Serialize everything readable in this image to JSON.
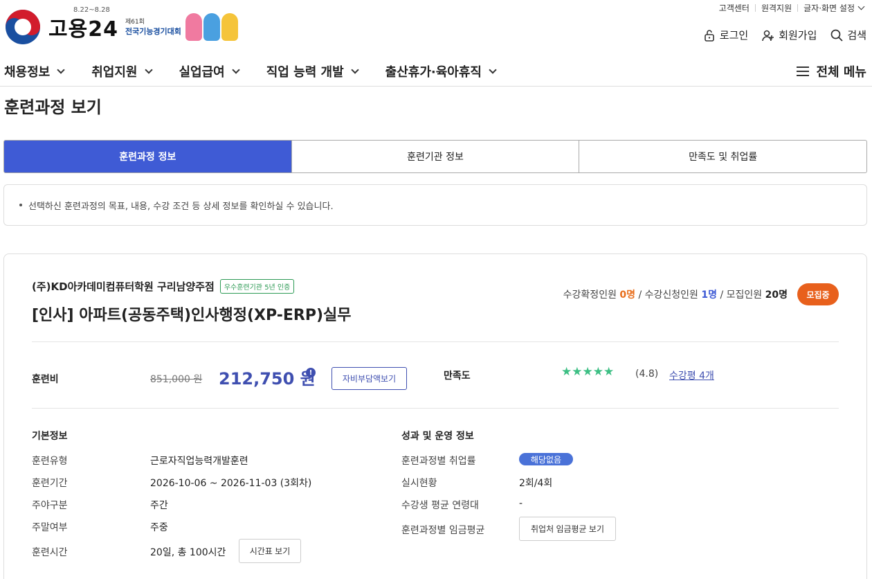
{
  "util": {
    "customer": "고객센터",
    "remote": "원격지원",
    "display": "글자·화면 설정"
  },
  "brand": {
    "name": "고용24",
    "date": "8.22~8.28",
    "event_small": "제61회",
    "event_name": "전국기능경기대회"
  },
  "account": {
    "login": "로그인",
    "signup": "회원가입",
    "search": "검색"
  },
  "gnb": {
    "items": [
      "채용정보",
      "취업지원",
      "실업급여",
      "직업 능력 개발",
      "출산휴가·육아휴직"
    ],
    "all_menu": "전체 메뉴"
  },
  "page_title": "훈련과정 보기",
  "tabs": [
    "훈련과정 정보",
    "훈련기관 정보",
    "만족도 및 취업률"
  ],
  "notice": "선택하신 훈련과정의 목표, 내용, 수강 조건 등 상세 정보를 확인하실 수 있습니다.",
  "course": {
    "org": "(주)KD아카데미컴퓨터학원 구리남양주점",
    "cert": "우수훈련기관 5년 인증",
    "title": "[인사] 아파트(공동주택)인사행정(XP-ERP)실무",
    "counts": {
      "confirmed_label": "수강확정인원",
      "confirmed": "0명",
      "applied_label": "수강신청인원",
      "applied": "1명",
      "recruit_label": "모집인원",
      "recruit": "20명"
    },
    "status": "모집중",
    "fee_label": "훈련비",
    "orig_price": "851,000 원",
    "price": "212,750 원",
    "self_pay_btn": "자비부담액보기",
    "sat_label": "만족도",
    "stars": "★★★★★",
    "score": "(4.8)",
    "reviews": "수강평 4개"
  },
  "basic": {
    "title": "기본정보",
    "rows": [
      {
        "label": "훈련유형",
        "value": "근로자직업능력개발훈련"
      },
      {
        "label": "훈련기간",
        "value": "2026-10-06 ~ 2026-11-03 (3회차)"
      },
      {
        "label": "주야구분",
        "value": "주간"
      },
      {
        "label": "주말여부",
        "value": "주중"
      },
      {
        "label": "훈련시간",
        "value": "20일, 총 100시간"
      }
    ],
    "timetable_btn": "시간표 보기"
  },
  "perf": {
    "title": "성과 및 운영 정보",
    "rows": [
      {
        "label": "훈련과정별 취업률",
        "value": "해당없음"
      },
      {
        "label": "실시현황",
        "value": "2회/4회"
      },
      {
        "label": "수강생 평균 연령대",
        "value": "-"
      },
      {
        "label": "훈련과정별 임금평균",
        "value": ""
      }
    ],
    "wage_btn": "취업처 임금평균 보기"
  }
}
